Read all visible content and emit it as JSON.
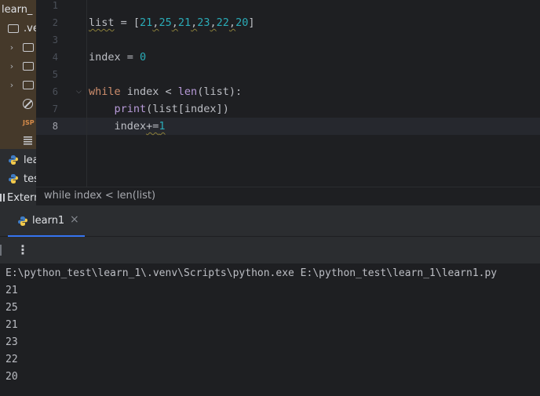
{
  "sidebar": {
    "items": [
      {
        "label": "learn_",
        "icon": "folder-icon",
        "kind": "root"
      },
      {
        "label": ".ve",
        "icon": "folder-icon",
        "kind": "folder"
      },
      {
        "label": "",
        "icon": "folder-icon",
        "kind": "folder-collapsed"
      },
      {
        "label": "",
        "icon": "folder-icon",
        "kind": "folder-collapsed"
      },
      {
        "label": "",
        "icon": "folder-icon",
        "kind": "folder-collapsed"
      },
      {
        "label": "",
        "icon": "excluded-icon",
        "kind": "file"
      },
      {
        "label": "JSP",
        "icon": "jsp-icon",
        "kind": "file"
      },
      {
        "label": "",
        "icon": "text-file-icon",
        "kind": "file"
      },
      {
        "label": "lea",
        "icon": "python-icon",
        "kind": "file"
      },
      {
        "label": "tes",
        "icon": "python-icon",
        "kind": "file"
      },
      {
        "label": "Extern",
        "icon": "library-icon",
        "kind": "section"
      }
    ]
  },
  "editor": {
    "lines": [
      {
        "num": "1",
        "text": ""
      },
      {
        "num": "2",
        "text": "list = [21,25,21,23,22,20]"
      },
      {
        "num": "3",
        "text": ""
      },
      {
        "num": "4",
        "text": "index = 0"
      },
      {
        "num": "5",
        "text": ""
      },
      {
        "num": "6",
        "text": "while index < len(list):"
      },
      {
        "num": "7",
        "text": "    print(list[index])"
      },
      {
        "num": "8",
        "text": "    index+=1"
      }
    ],
    "active_line": "8"
  },
  "breadcrumb": {
    "text": "while index < len(list)"
  },
  "run": {
    "tab_label": "learn1",
    "tab_close": "×",
    "toolbar_more": "⋮",
    "command": "E:\\python_test\\learn_1\\.venv\\Scripts\\python.exe E:\\python_test\\learn_1\\learn1.py",
    "output": [
      "21",
      "25",
      "21",
      "23",
      "22",
      "20"
    ]
  },
  "colors": {
    "keyword": "#cf8e6d",
    "number": "#2aacb8",
    "builtin": "#b89bd9",
    "accent": "#3574f0"
  }
}
